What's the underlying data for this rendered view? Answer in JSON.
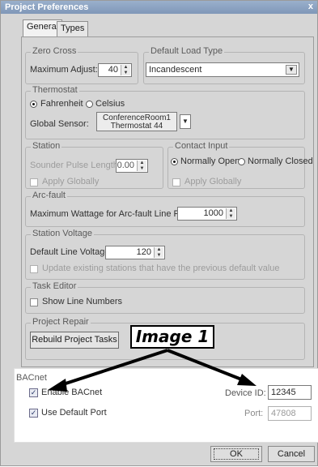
{
  "window": {
    "title": "Project Preferences",
    "close_glyph": "x"
  },
  "tabs": [
    {
      "label": "General",
      "active": true
    },
    {
      "label": "Types",
      "active": false
    }
  ],
  "zero_cross": {
    "group_label": "Zero Cross",
    "max_adjust_label": "Maximum Adjust:",
    "max_adjust_value": "40"
  },
  "default_load": {
    "group_label": "Default Load Type",
    "value": "Incandescent"
  },
  "thermostat": {
    "group_label": "Thermostat",
    "fahrenheit": "Fahrenheit",
    "celsius": "Celsius",
    "selected": "Fahrenheit",
    "sensor_label": "Global Sensor:",
    "sensor_line1": "ConferenceRoom1",
    "sensor_line2": "Thermostat 44"
  },
  "station": {
    "group_label": "Station",
    "sounder_label": "Sounder Pulse Length:",
    "sounder_value": "0.00",
    "apply_globally": "Apply Globally"
  },
  "contact_input": {
    "group_label": "Contact Input",
    "normally_open": "Normally Open",
    "normally_closed": "Normally Closed",
    "selected": "Normally Open",
    "apply_globally": "Apply Globally"
  },
  "arc_fault": {
    "group_label": "Arc-fault",
    "label": "Maximum Wattage for Arc-fault Line Feed:",
    "value": "1000"
  },
  "station_voltage": {
    "group_label": "Station Voltage",
    "default_label": "Default Line Voltage:",
    "default_value": "120",
    "update_label": "Update existing stations that have the previous default value"
  },
  "task_editor": {
    "group_label": "Task Editor",
    "show_line_numbers": "Show Line Numbers"
  },
  "project_repair": {
    "group_label": "Project Repair",
    "rebuild_button": "Rebuild Project Tasks"
  },
  "bacnet": {
    "group_label": "BACnet",
    "enable_label": "Enable BACnet",
    "enable_checked": true,
    "device_id_label": "Device ID:",
    "device_id_value": "12345",
    "default_port_label": "Use Default Port",
    "default_port_checked": true,
    "port_label": "Port:",
    "port_value": "47808"
  },
  "footer": {
    "ok_label": "OK",
    "cancel_label": "Cancel"
  },
  "annotation": {
    "callout_text": "Image 1"
  },
  "colors": {
    "titlebar": "#8aa3c2",
    "dialog_bg": "#d6d6d6",
    "highlight_bg": "#ffffff"
  }
}
